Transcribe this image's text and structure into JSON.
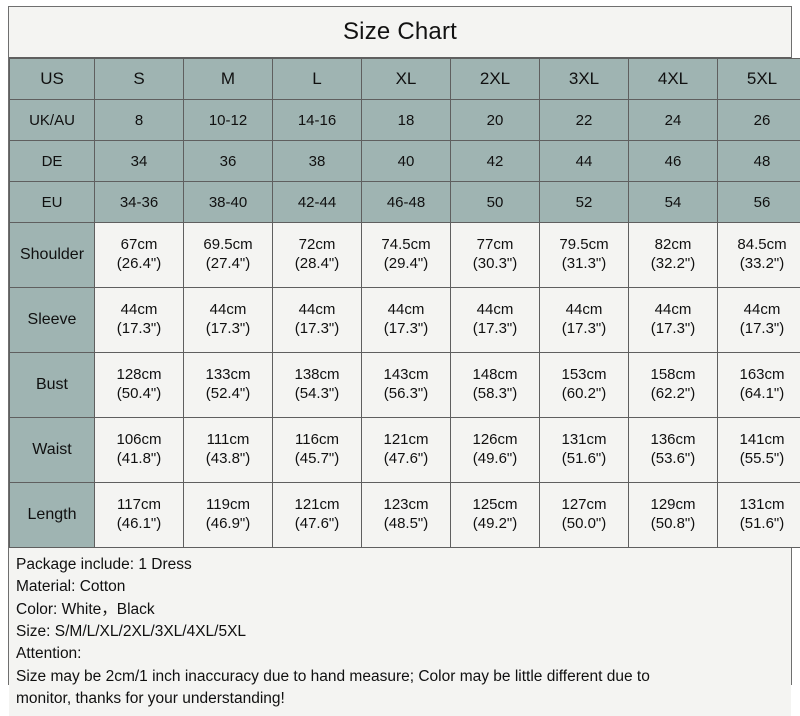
{
  "title": "Size Chart",
  "table": {
    "size_header": {
      "label": "US",
      "sizes": [
        "S",
        "M",
        "L",
        "XL",
        "2XL",
        "3XL",
        "4XL",
        "5XL"
      ]
    },
    "conversion_rows": [
      {
        "label": "UK/AU",
        "values": [
          "8",
          "10-12",
          "14-16",
          "18",
          "20",
          "22",
          "24",
          "26"
        ]
      },
      {
        "label": "DE",
        "values": [
          "34",
          "36",
          "38",
          "40",
          "42",
          "44",
          "46",
          "48"
        ]
      },
      {
        "label": "EU",
        "values": [
          "34-36",
          "38-40",
          "42-44",
          "46-48",
          "50",
          "52",
          "54",
          "56"
        ]
      }
    ],
    "measurement_rows": [
      {
        "label": "Shoulder",
        "cm": [
          "67cm",
          "69.5cm",
          "72cm",
          "74.5cm",
          "77cm",
          "79.5cm",
          "82cm",
          "84.5cm"
        ],
        "inch": [
          "(26.4\")",
          "(27.4\")",
          "(28.4\")",
          "(29.4\")",
          "(30.3\")",
          "(31.3\")",
          "(32.2\")",
          "(33.2\")"
        ]
      },
      {
        "label": "Sleeve",
        "cm": [
          "44cm",
          "44cm",
          "44cm",
          "44cm",
          "44cm",
          "44cm",
          "44cm",
          "44cm"
        ],
        "inch": [
          "(17.3\")",
          "(17.3\")",
          "(17.3\")",
          "(17.3\")",
          "(17.3\")",
          "(17.3\")",
          "(17.3\")",
          "(17.3\")"
        ]
      },
      {
        "label": "Bust",
        "cm": [
          "128cm",
          "133cm",
          "138cm",
          "143cm",
          "148cm",
          "153cm",
          "158cm",
          "163cm"
        ],
        "inch": [
          "(50.4\")",
          "(52.4\")",
          "(54.3\")",
          "(56.3\")",
          "(58.3\")",
          "(60.2\")",
          "(62.2\")",
          "(64.1\")"
        ]
      },
      {
        "label": "Waist",
        "cm": [
          "106cm",
          "111cm",
          "116cm",
          "121cm",
          "126cm",
          "131cm",
          "136cm",
          "141cm"
        ],
        "inch": [
          "(41.8\")",
          "(43.8\")",
          "(45.7\")",
          "(47.6\")",
          "(49.6\")",
          "(51.6\")",
          "(53.6\")",
          "(55.5\")"
        ]
      },
      {
        "label": "Length",
        "cm": [
          "117cm",
          "119cm",
          "121cm",
          "123cm",
          "125cm",
          "127cm",
          "129cm",
          "131cm"
        ],
        "inch": [
          "(46.1\")",
          "(46.9\")",
          "(47.6\")",
          "(48.5\")",
          "(49.2\")",
          "(50.0\")",
          "(50.8\")",
          "(51.6\")"
        ]
      }
    ]
  },
  "footer": {
    "line1": "Package include: 1 Dress",
    "line2": "Material: Cotton",
    "line3": "Color: White，Black",
    "line4": "Size: S/M/L/XL/2XL/3XL/4XL/5XL",
    "line5": "Attention:",
    "line6": "Size may be 2cm/1 inch inaccuracy due to hand measure; Color may be little different due to",
    "line7": "monitor, thanks for your understanding!"
  },
  "colors": {
    "header_teal": "#9fb4b2",
    "cell_bg": "#f4f4f2",
    "border": "#5f5f5f",
    "text": "#101010"
  }
}
